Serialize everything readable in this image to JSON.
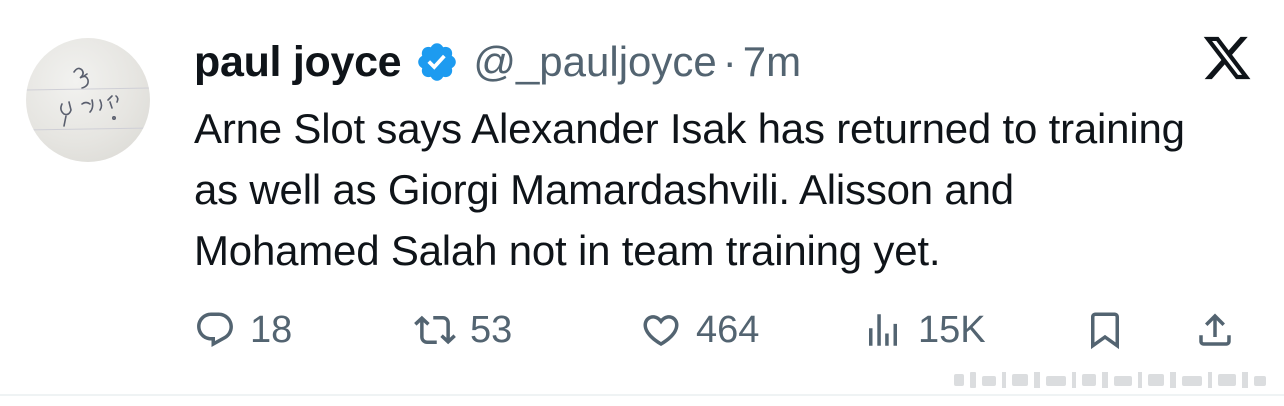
{
  "tweet": {
    "author_name": "paul joyce",
    "handle": "@_pauljoyce",
    "separator": "·",
    "time": "7m",
    "verified": true,
    "verified_color": "#1d9bf0",
    "text": "Arne Slot says Alexander Isak has returned to training as well as Giorgi Mamardashvili. Alisson and Mohamed Salah not in team training yet."
  },
  "actions": {
    "reply": {
      "icon": "reply-icon",
      "count": "18"
    },
    "retweet": {
      "icon": "retweet-icon",
      "count": "53"
    },
    "like": {
      "icon": "heart-icon",
      "count": "464"
    },
    "views": {
      "icon": "views-icon",
      "count": "15K"
    },
    "bookmark": {
      "icon": "bookmark-icon"
    },
    "share": {
      "icon": "share-icon"
    }
  },
  "branding": {
    "logo": "x-logo"
  },
  "colors": {
    "text": "#0f1419",
    "secondary": "#536471",
    "accent": "#1d9bf0"
  }
}
